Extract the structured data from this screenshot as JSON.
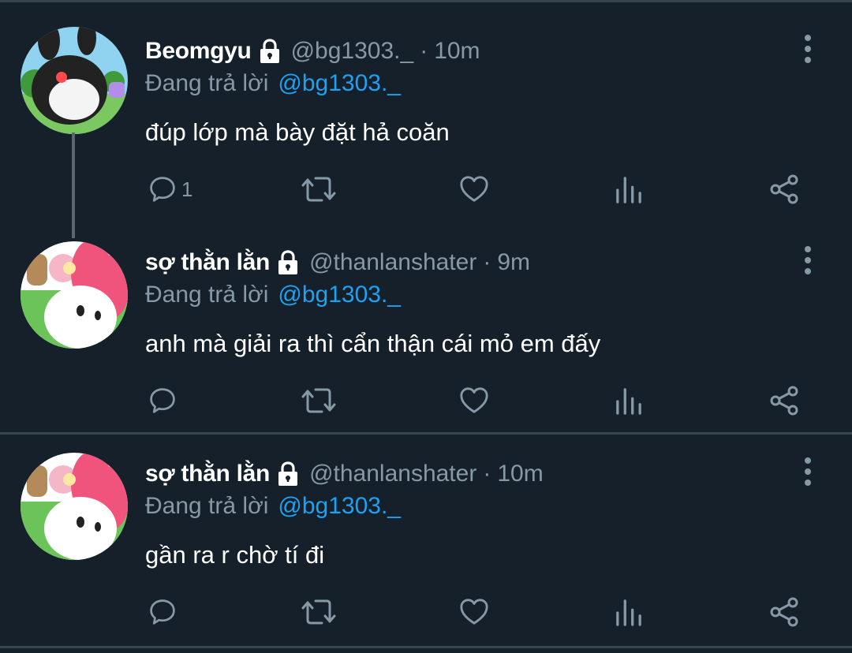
{
  "tweets": [
    {
      "name": "Beomgyu",
      "handle": "@bg1303._",
      "separator": "·",
      "time": "10m",
      "reply_label": "Đang trả lời",
      "reply_to": "@bg1303._",
      "text": "đúp lớp mà bày đặt hả coăn",
      "reply_count": "1",
      "locked": true,
      "avatar": "dark-rabbit-character-avatar"
    },
    {
      "name": "sợ thằn lằn",
      "handle": "@thanlanshater",
      "separator": "·",
      "time": "9m",
      "reply_label": "Đang trả lời",
      "reply_to": "@bg1303._",
      "text": "anh mà giải ra thì cẩn thận cái mỏ em đấy",
      "reply_count": "",
      "locked": true,
      "avatar": "pink-bunny-character-avatar"
    },
    {
      "name": "sợ thằn lằn",
      "handle": "@thanlanshater",
      "separator": "·",
      "time": "10m",
      "reply_label": "Đang trả lời",
      "reply_to": "@bg1303._",
      "text": "gần ra r chờ tí đi",
      "reply_count": "",
      "locked": true,
      "avatar": "pink-bunny-character-avatar"
    }
  ],
  "icons": {
    "reply": "reply-icon",
    "retweet": "retweet-icon",
    "like": "like-icon",
    "analytics": "analytics-icon",
    "share": "share-icon",
    "lock": "lock-icon",
    "more": "more-icon"
  },
  "colors": {
    "background": "#15202b",
    "text": "#ffffff",
    "secondary": "#8899a6",
    "link": "#1da1f2",
    "divider": "#38444d"
  }
}
